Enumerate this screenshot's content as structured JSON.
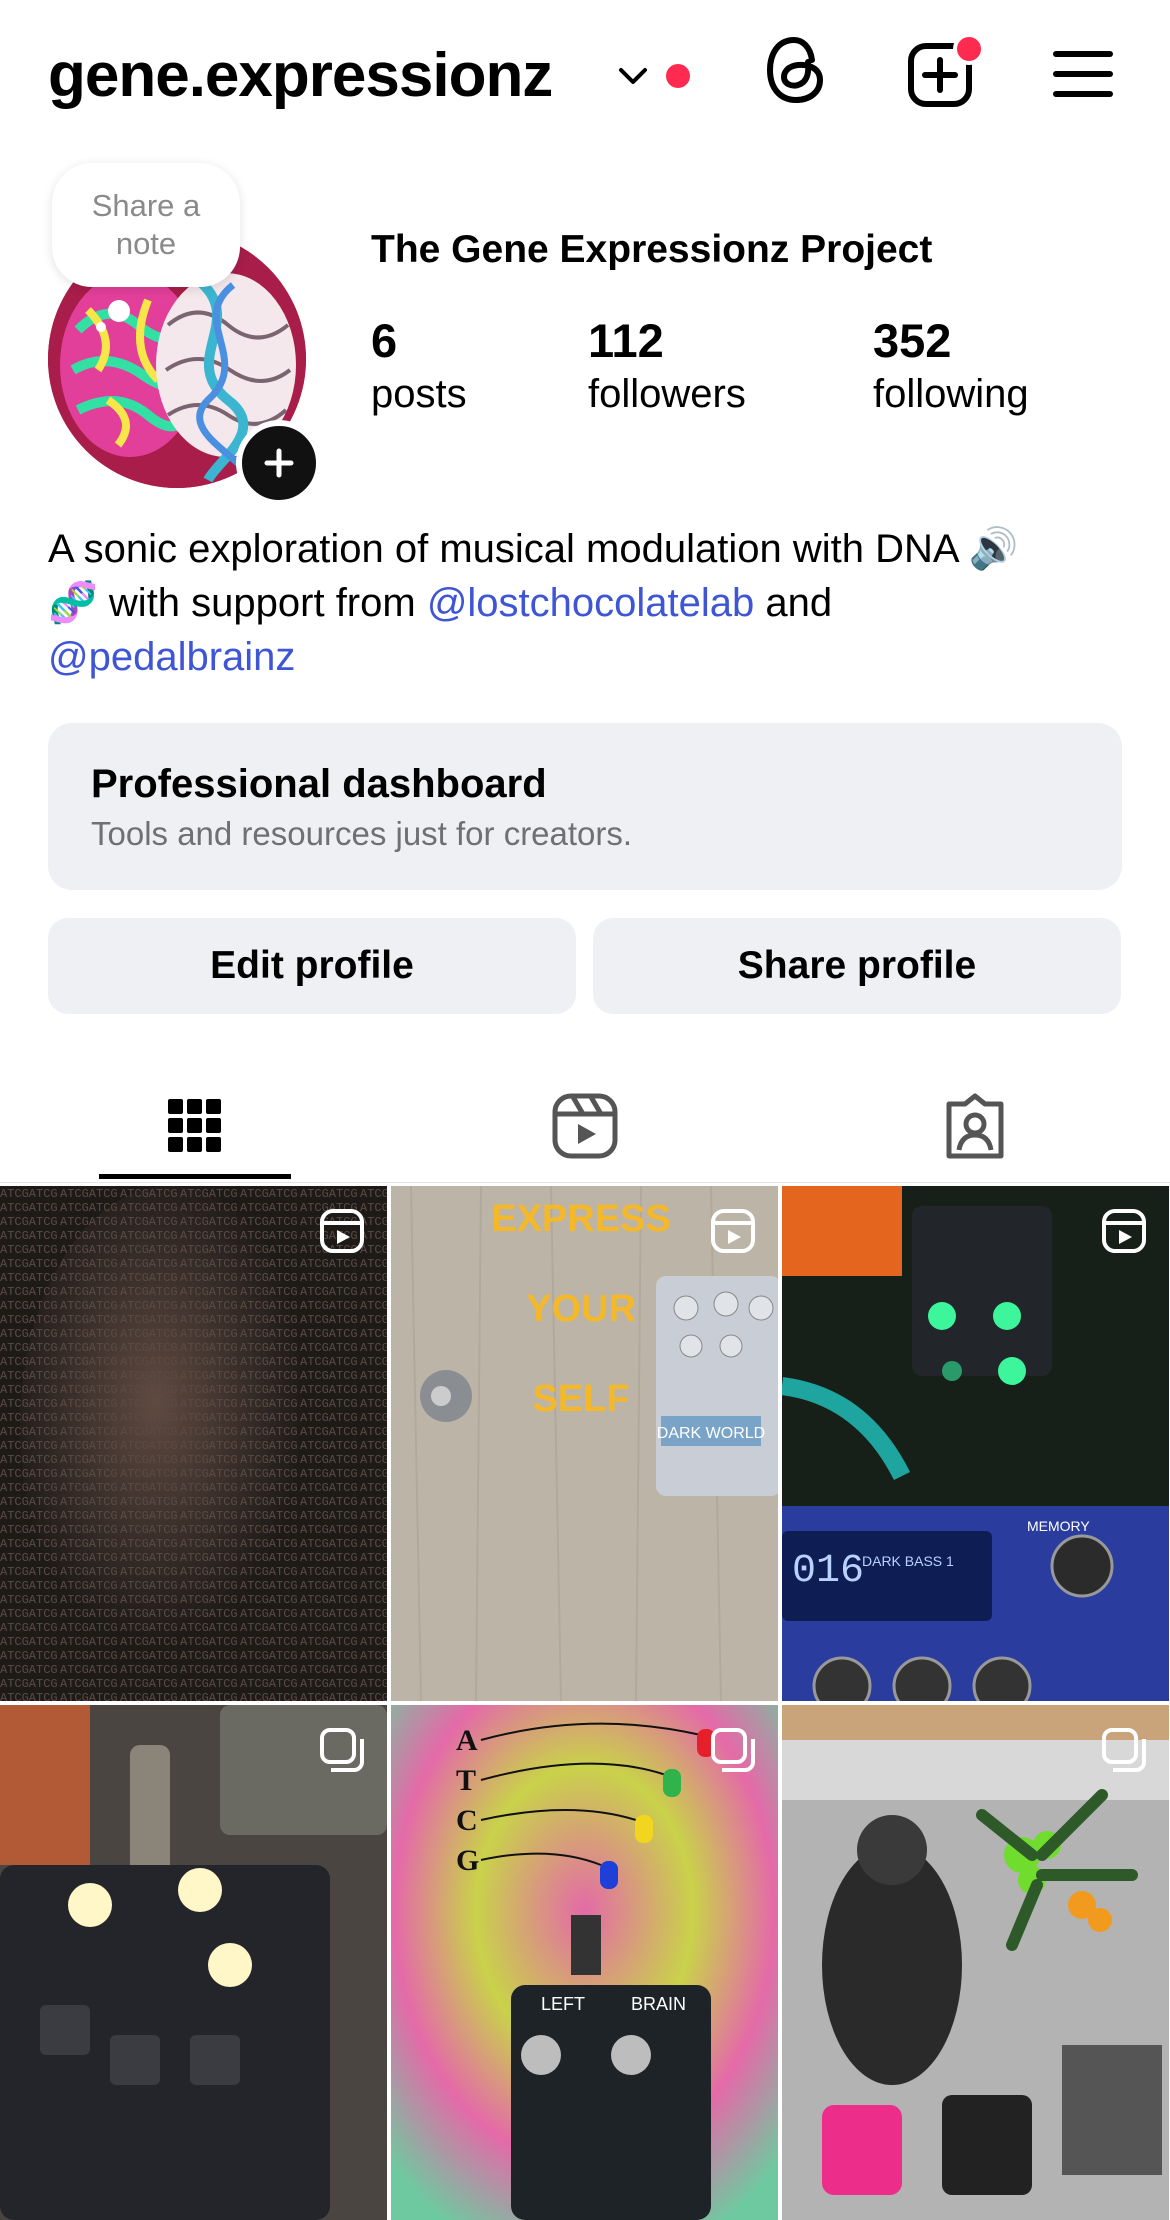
{
  "header": {
    "username": "gene.expressionz",
    "icons": [
      "chevron-down-icon",
      "notification-dot",
      "threads-icon",
      "create-post-icon",
      "menu-icon"
    ],
    "accent_red": "#ff2a4f"
  },
  "profile": {
    "note_prompt": "Share a note",
    "full_name": "The Gene Expressionz Project",
    "stats": {
      "posts": {
        "value": "6",
        "label": "posts"
      },
      "followers": {
        "value": "112",
        "label": "followers"
      },
      "following": {
        "value": "352",
        "label": "following"
      }
    },
    "bio": {
      "text_1": "A sonic exploration of musical modulation with DNA 🔊",
      "text_2": "🧬 with support from ",
      "mention_1": "@lostchocolatelab",
      "text_3": " and",
      "mention_2": "@pedalbrainz"
    },
    "mention_color": "#3e55d6"
  },
  "pro_dashboard": {
    "title": "Professional dashboard",
    "subtitle": "Tools and resources just for creators."
  },
  "buttons": {
    "edit": "Edit profile",
    "share": "Share profile"
  },
  "tabs": [
    {
      "name": "grid",
      "icon": "grid-icon",
      "active": true
    },
    {
      "name": "reels",
      "icon": "reels-icon",
      "active": false
    },
    {
      "name": "tagged",
      "icon": "tagged-icon",
      "active": false
    }
  ],
  "posts": [
    {
      "type": "reel",
      "overlay_text": ""
    },
    {
      "type": "reel",
      "overlay_text": "EXPRESS YOUR SELF",
      "pedal_label": "DARK WORLD"
    },
    {
      "type": "reel",
      "screen_text": "016",
      "screen_label": "DARK BASS 1",
      "knob_label": "MEMORY"
    },
    {
      "type": "carousel",
      "overlay_text": ""
    },
    {
      "type": "carousel",
      "letters": [
        "A",
        "T",
        "C",
        "G"
      ],
      "device_labels": [
        "LEFT",
        "BRAIN"
      ]
    },
    {
      "type": "carousel",
      "overlay_text": ""
    }
  ]
}
